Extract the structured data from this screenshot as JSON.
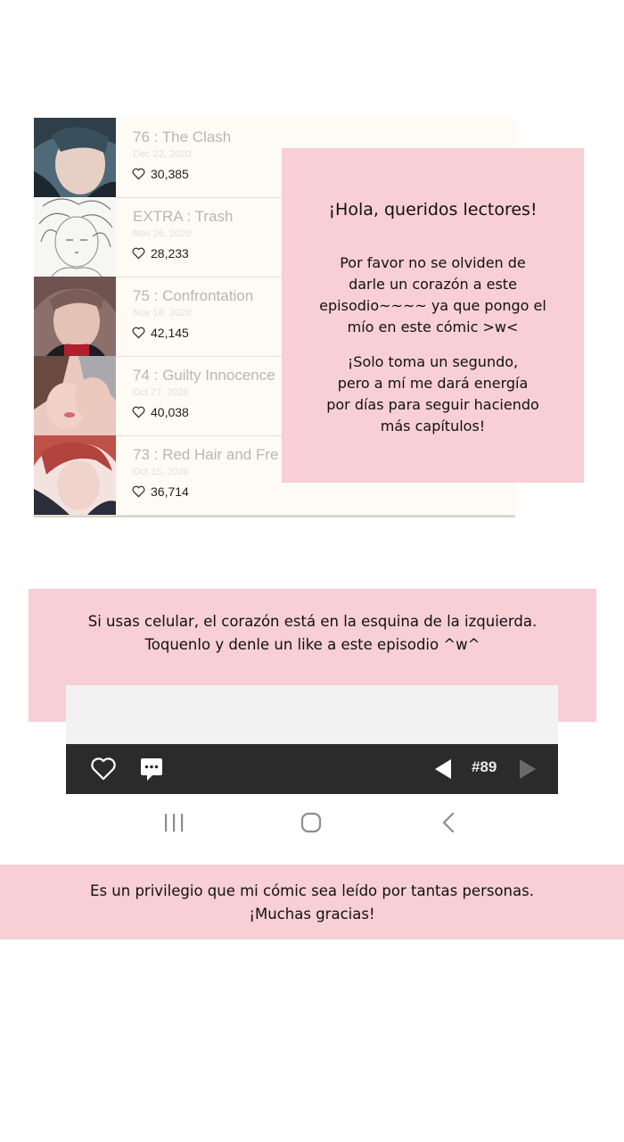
{
  "episodes": [
    {
      "title": "76 : The Clash",
      "date": "Dec 22, 2020",
      "likes": "30,385"
    },
    {
      "title": "EXTRA : Trash",
      "date": "Nov 26, 2020",
      "likes": "28,233"
    },
    {
      "title": "75 : Confrontation",
      "date": "Nov 16, 2020",
      "likes": "42,145"
    },
    {
      "title": "74 : Guilty Innocence",
      "date": "Oct 27, 2020",
      "likes": "40,038"
    },
    {
      "title": "73 : Red Hair and Fre",
      "date": "Oct 15, 2020",
      "likes": "36,714"
    }
  ],
  "info_box": {
    "title": "¡Hola, queridos lectores!",
    "line1": "Por favor no se olviden de",
    "line2": "darle un corazón a este",
    "line3": "episodio~~~~ ya que pongo el",
    "line4": "mío en este cómic >w<",
    "line5": "¡Solo toma un segundo,",
    "line6": "pero a mí me dará energía",
    "line7": "por días para seguir haciendo",
    "line8": "más capítulos!"
  },
  "middle_note": {
    "line1": "Si usas celular, el corazón está en la esquina de la izquierda.",
    "line2": "Toquenlo y denle un like a este episodio ^w^"
  },
  "bottom_bar": {
    "episode_number": "#89",
    "icons": [
      "heart-icon",
      "comment-icon",
      "prev-arrow-icon",
      "next-arrow-icon"
    ]
  },
  "system_nav": {
    "icons": [
      "recent-apps-icon",
      "home-icon",
      "back-icon"
    ]
  },
  "footer_note": {
    "line1": "Es un privilegio que mi cómic sea leído por tantas personas.",
    "line2": "¡Muchas gracias!"
  },
  "colors": {
    "pink": "#f7cfd4",
    "list_bg": "#fdfbf3",
    "bar": "#2b2b2b"
  }
}
